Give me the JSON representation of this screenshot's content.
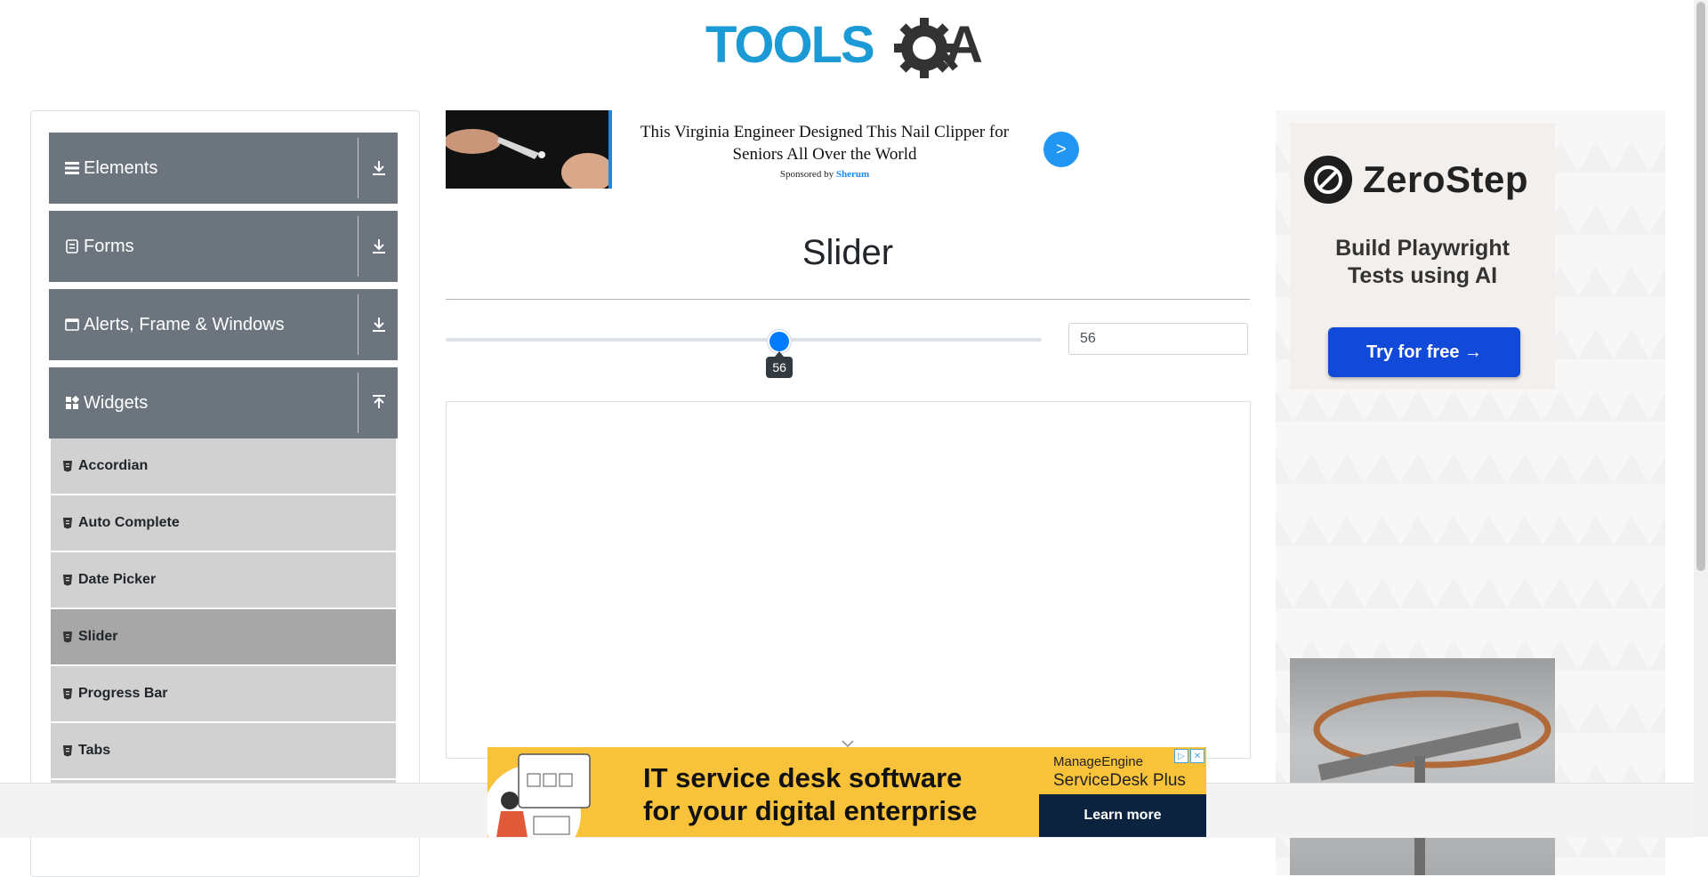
{
  "header": {
    "logo_alt": "TOOLSQA"
  },
  "sidebar": {
    "groups": [
      {
        "title": "Elements",
        "icon": "hamburger-icon"
      },
      {
        "title": "Forms",
        "icon": "form-icon"
      },
      {
        "title": "Alerts, Frame & Windows",
        "icon": "window-icon"
      },
      {
        "title": "Widgets",
        "icon": "widgets-icon"
      }
    ],
    "widget_items": [
      {
        "label": "Accordian"
      },
      {
        "label": "Auto Complete"
      },
      {
        "label": "Date Picker"
      },
      {
        "label": "Slider",
        "active": true
      },
      {
        "label": "Progress Bar"
      },
      {
        "label": "Tabs"
      }
    ]
  },
  "top_ad": {
    "headline": "This Virginia Engineer Designed This Nail Clipper for Seniors All Over the World",
    "sponsor_prefix": "Sponsored by",
    "sponsor_name": "Sherum",
    "go_label": ">"
  },
  "main": {
    "title": "Slider",
    "slider": {
      "min": 0,
      "max": 100,
      "value": 56,
      "tooltip": "56"
    },
    "value_field": "56"
  },
  "right_ad": {
    "brand": "ZeroStep",
    "copy_line1": "Build Playwright",
    "copy_line2": "Tests using AI",
    "cta": "Try for free →"
  },
  "bottom_ad": {
    "line1": "IT service desk software",
    "line2": "for your digital enterprise",
    "brand_top": "ManageEngine",
    "brand_bottom": "ServiceDesk Plus",
    "cta": "Learn more"
  },
  "colors": {
    "accent": "#007bff",
    "sidebar_header": "#6c757d",
    "menu_item": "#d1d1d1",
    "menu_item_active": "#a7a7a7"
  }
}
